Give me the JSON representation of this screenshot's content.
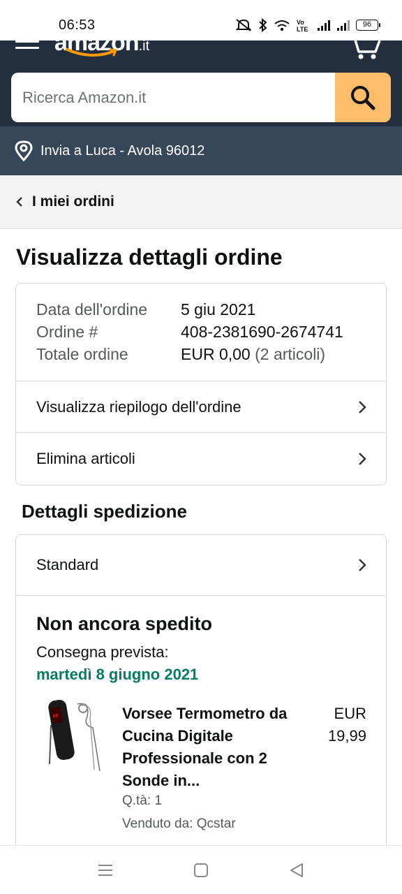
{
  "status_bar": {
    "time": "06:53",
    "battery": "96",
    "volte": "Vo LTE",
    "icons": [
      "mute-icon",
      "bluetooth-icon",
      "wifi-icon",
      "volte-icon",
      "signal-icon",
      "signal-icon",
      "battery-icon"
    ]
  },
  "header": {
    "logo_word": "amazon",
    "logo_tld": ".it",
    "search_placeholder": "Ricerca Amazon.it",
    "colors": {
      "topbar": "#232f3e",
      "deliverbar": "#37475a",
      "search_button": "#febd69"
    }
  },
  "delivery": {
    "label": "Invia a Luca - Avola 96012"
  },
  "breadcrumb": {
    "label": "I miei ordini"
  },
  "page_title": "Visualizza dettagli ordine",
  "order": {
    "date_label": "Data dell'ordine",
    "date_value": "5 giu 2021",
    "number_label": "Ordine #",
    "number_value": "408-2381690-2674741",
    "total_label": "Totale ordine",
    "total_value": "EUR 0,00",
    "total_items": "(2 articoli)",
    "summary_link": "Visualizza riepilogo dell'ordine",
    "delete_link": "Elimina articoli"
  },
  "shipping": {
    "section_title": "Dettagli spedizione",
    "method": "Standard",
    "status": "Non ancora spedito",
    "delivery_label": "Consegna prevista:",
    "delivery_date": "martedì 8 giugno 2021",
    "delivery_date_color": "#067d62"
  },
  "product": {
    "title": "Vorsee Termometro da Cucina Digitale Professionale con 2 Sonde in...",
    "price_currency": "EUR",
    "price_value": "19,99",
    "qty": "Q.tà: 1",
    "seller": "Venduto da: Qcstar"
  }
}
